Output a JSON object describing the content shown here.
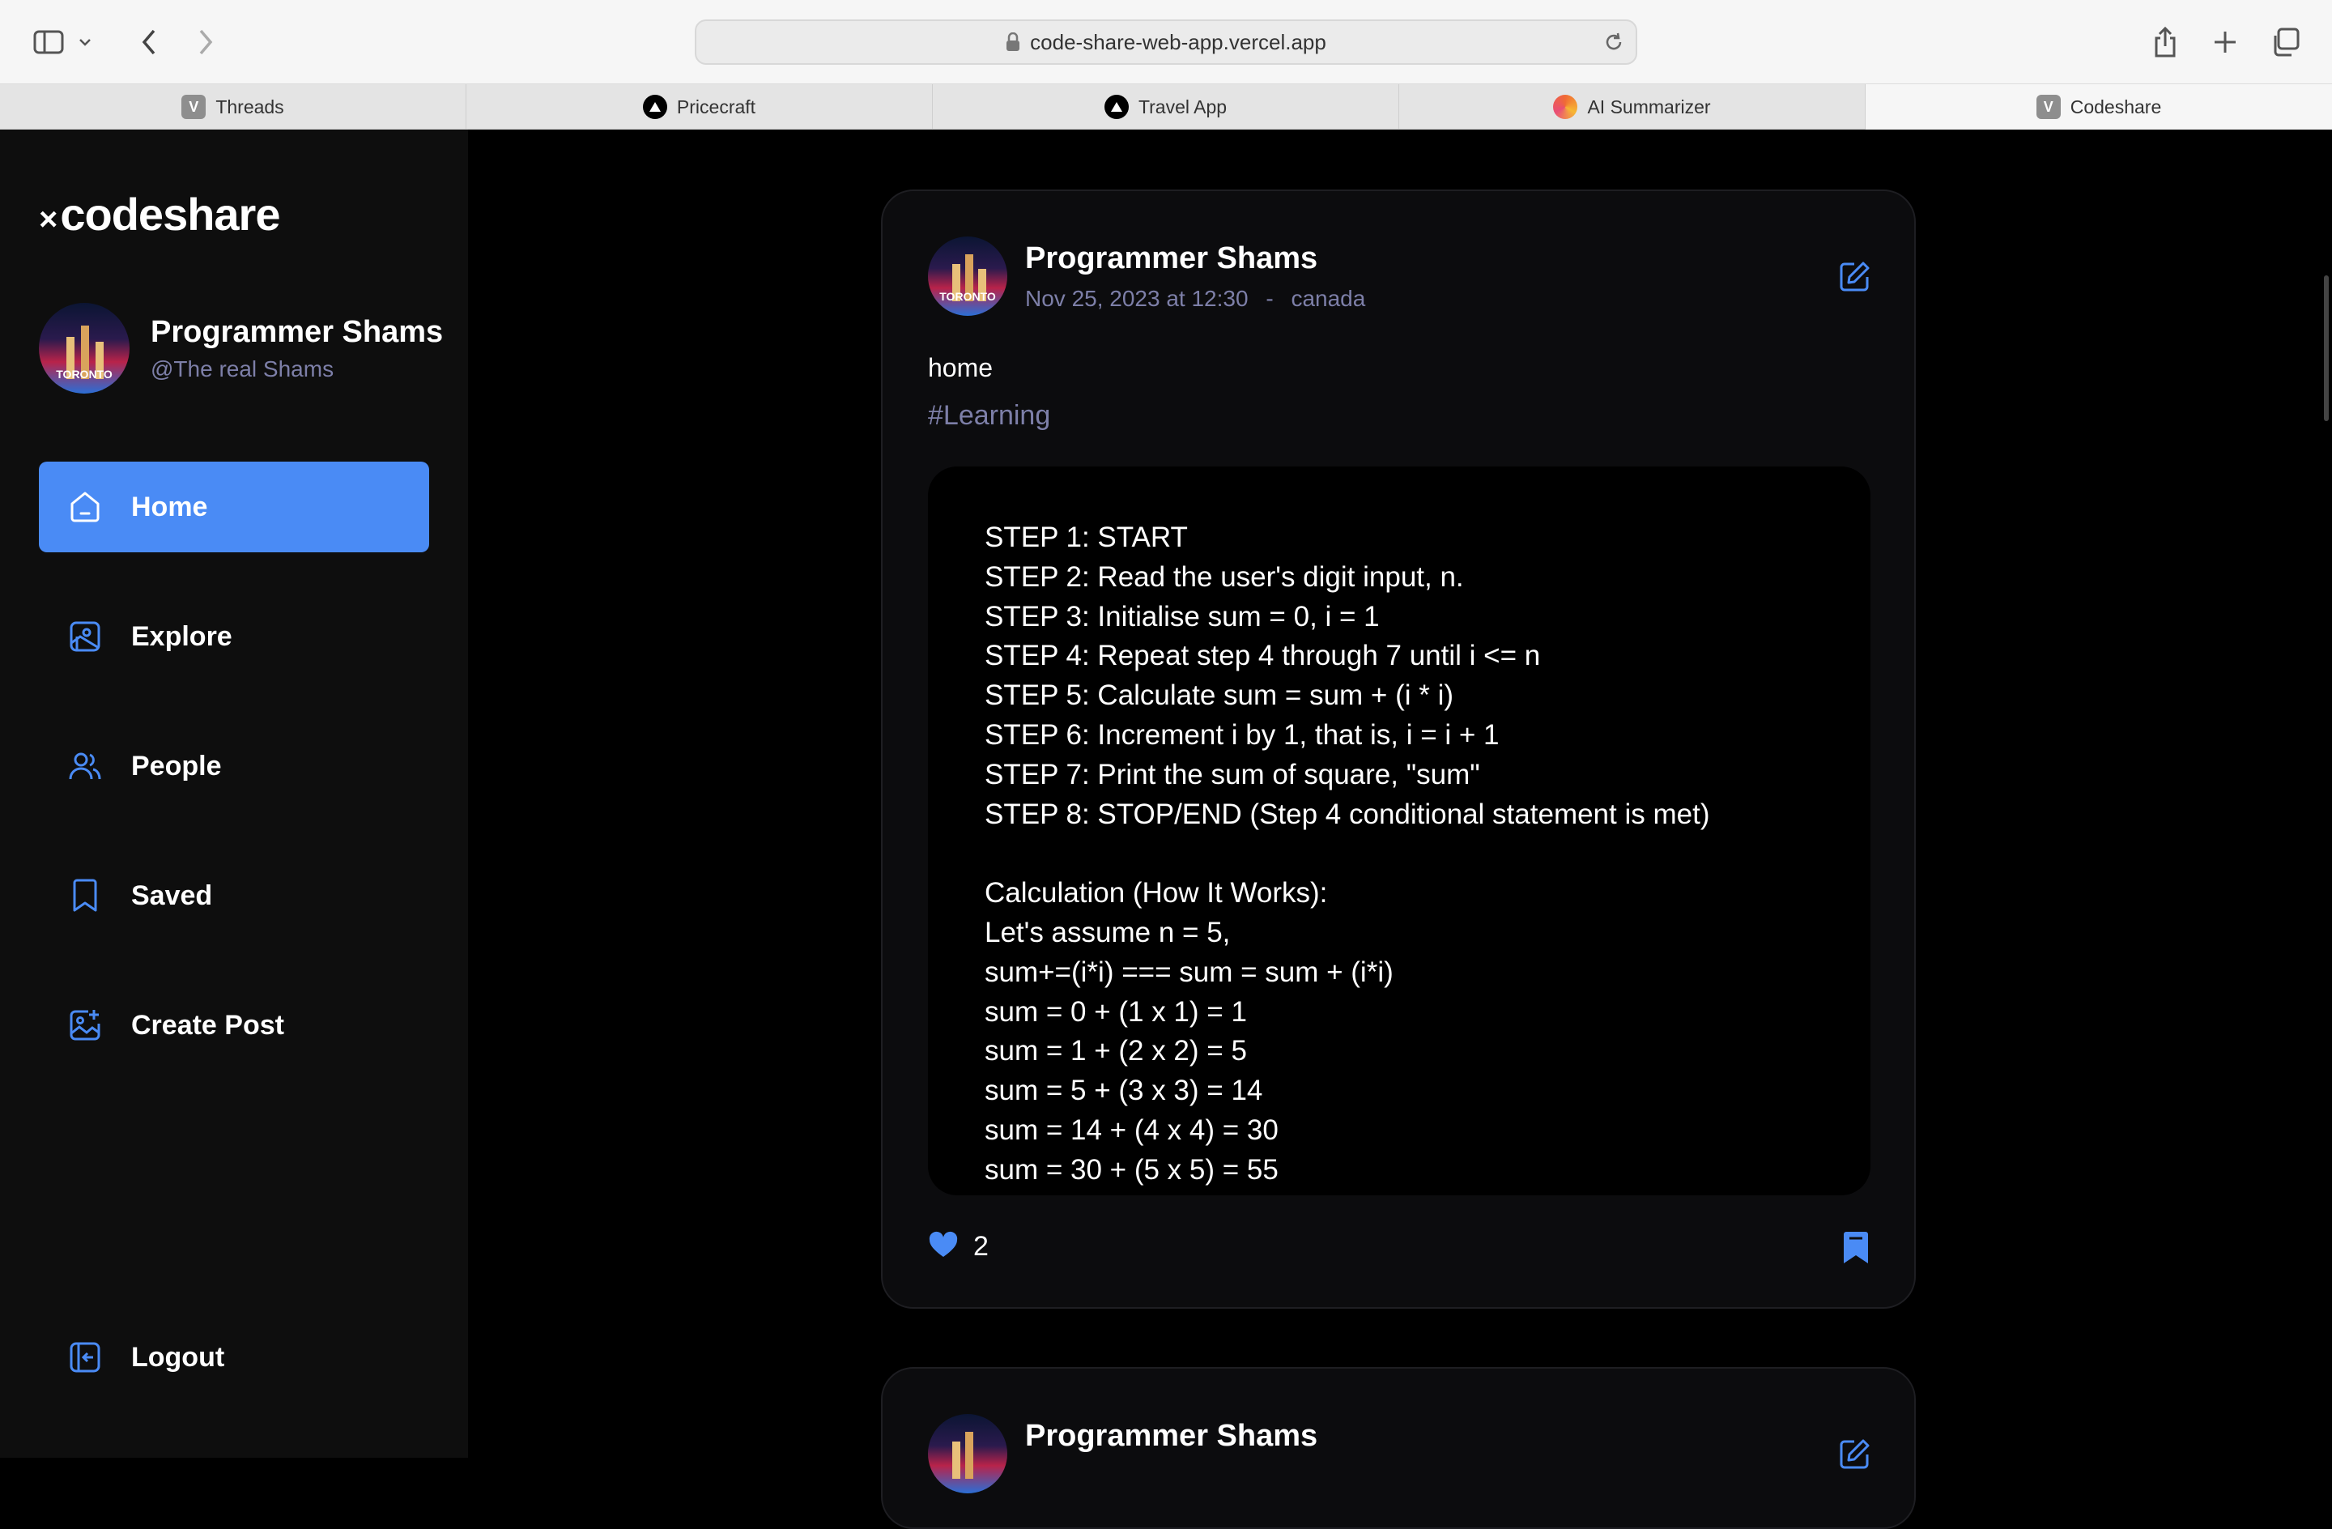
{
  "browser": {
    "url": "code-share-web-app.vercel.app",
    "tabs": [
      {
        "label": "Threads",
        "favicon": "v-icon"
      },
      {
        "label": "Pricecraft",
        "favicon": "triangle-icon"
      },
      {
        "label": "Travel App",
        "favicon": "triangle-icon"
      },
      {
        "label": "AI Summarizer",
        "favicon": "ai-icon"
      },
      {
        "label": "Codeshare",
        "favicon": "v-icon",
        "active": true
      }
    ]
  },
  "sidebar": {
    "logo": "codeshare",
    "logo_mark": "×",
    "profile": {
      "name": "Programmer Shams",
      "handle": "@The real Shams",
      "avatar_text": "TORONTO"
    },
    "items": [
      {
        "label": "Home",
        "icon": "home-icon",
        "active": true
      },
      {
        "label": "Explore",
        "icon": "gallery-icon"
      },
      {
        "label": "People",
        "icon": "people-icon"
      },
      {
        "label": "Saved",
        "icon": "bookmark-icon"
      },
      {
        "label": "Create Post",
        "icon": "image-plus-icon"
      }
    ],
    "logout": "Logout"
  },
  "post": {
    "author": "Programmer Shams",
    "date": "Nov 25, 2023 at 12:30",
    "separator": "-",
    "location": "canada",
    "caption": "home",
    "tag": "#Learning",
    "code_lines": [
      "STEP 1: START",
      "STEP 2: Read the user's digit input, n.",
      "STEP 3: Initialise sum = 0, i = 1",
      "STEP 4: Repeat step 4 through 7 until i <= n",
      "STEP 5: Calculate sum = sum + (i * i)",
      "STEP 6: Increment i by 1, that is, i = i + 1",
      "STEP 7: Print the sum of square, \"sum\"",
      "STEP 8: STOP/END (Step 4 conditional statement is met)",
      "",
      "Calculation (How It Works):",
      "Let's assume n = 5,",
      "sum+=(i*i) === sum = sum + (i*i)",
      "sum = 0 + (1 x 1) = 1",
      "sum = 1 + (2 x 2) = 5",
      "sum = 5 + (3 x 3) = 14",
      "sum = 14 + (4 x 4) = 30",
      "sum = 30 + (5 x 5) = 55"
    ],
    "likes": "2"
  },
  "next_post": {
    "author": "Programmer Shams"
  },
  "colors": {
    "accent": "#4a8bf5",
    "muted": "#7d7fa8",
    "background": "#000000",
    "sidebar": "#0e0e0e"
  }
}
